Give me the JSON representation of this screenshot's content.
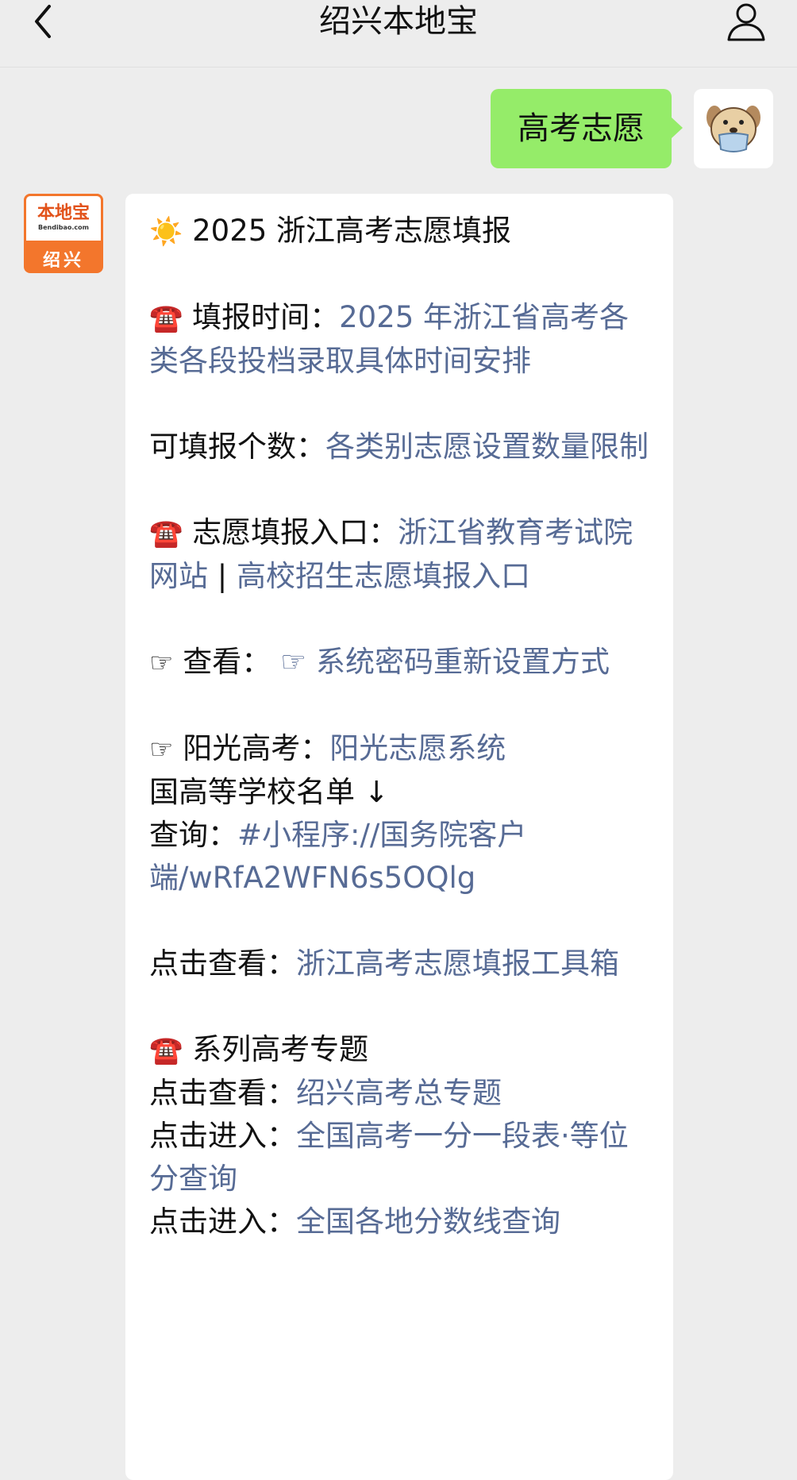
{
  "header": {
    "title": "绍兴本地宝"
  },
  "outgoing": {
    "text": "高考志愿"
  },
  "bot": {
    "avatar_logo": "本地宝",
    "avatar_site": "Bendibao.com",
    "avatar_city": "绍兴"
  },
  "message": {
    "heading_icon": "☀️",
    "heading": "2025 浙江高考志愿填报",
    "p1_icon": "☎️",
    "p1_label": "填报时间：",
    "p1_link": "2025 年浙江省高考各类各段投档录取具体时间安排",
    "p2_label": "可填报个数：",
    "p2_link": "各类别志愿设置数量限制",
    "p3_icon": "☎️",
    "p3_label": "志愿填报入口：",
    "p3_link1": "浙江省教育考试院网站",
    "p3_sep": " | ",
    "p3_link2": "高校招生志愿填报入口",
    "p4_icon": "☞",
    "p4_label": "查看：",
    "p4_link_icon": "☞",
    "p4_link": "系统密码重新设置方式",
    "p5_icon": "☞",
    "p5_label": "阳光高考：",
    "p5_link": "阳光志愿系统",
    "p5_line2": "国高等学校名单 ↓",
    "p5_line3_label": "查询：",
    "p5_line3_link": "#小程序://国务院客户端/wRfA2WFN6s5OQlg",
    "p6_label": "点击查看：",
    "p6_link": "浙江高考志愿填报工具箱",
    "p7_icon": "☎️",
    "p7_heading": "系列高考专题",
    "p7_l1_label": "点击查看：",
    "p7_l1_link": "绍兴高考总专题",
    "p7_l2_label": "点击进入：",
    "p7_l2_link": "全国高考一分一段表·等位分查询",
    "p7_l3_label": "点击进入：",
    "p7_l3_link": "全国各地分数线查询"
  },
  "colors": {
    "background": "#ededed",
    "outgoing_bubble": "#95ec69",
    "incoming_bubble": "#ffffff",
    "link": "#576b95",
    "brand_orange": "#f3762c"
  },
  "icons": {
    "back": "chevron-left-icon",
    "profile": "person-icon"
  }
}
